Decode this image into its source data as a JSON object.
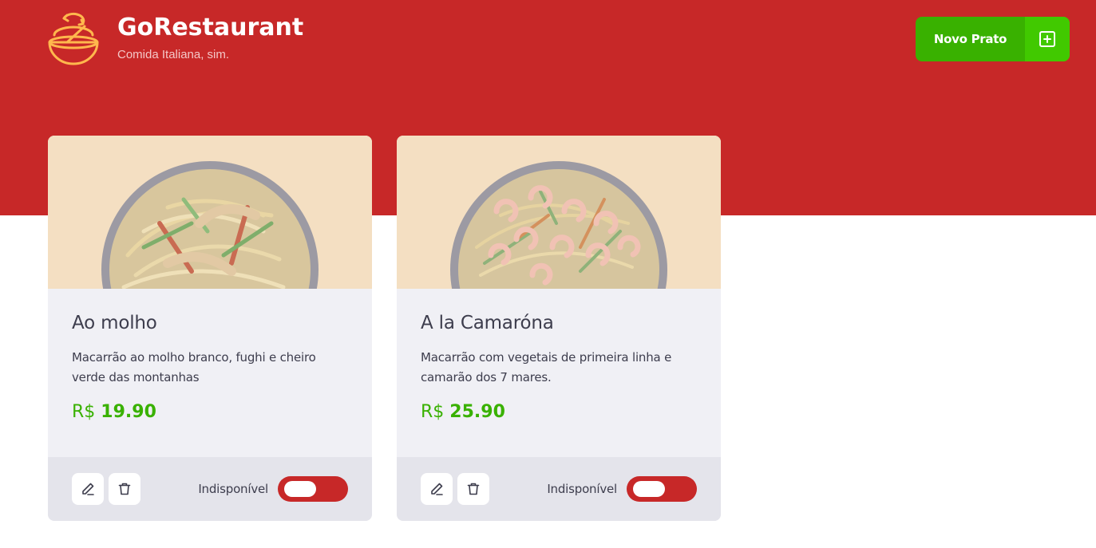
{
  "header": {
    "logo_icon": "bowl-icon",
    "title": "GoRestaurant",
    "subtitle": "Comida Italiana, sim.",
    "new_button": {
      "label": "Novo Prato",
      "icon": "plus-square-icon"
    }
  },
  "colors": {
    "header_bg": "#c72828",
    "accent_green": "#39b100",
    "button_icon_bg": "#41c900",
    "card_bg": "#f0f0f5",
    "card_footer_bg": "#e4e4eb",
    "image_bg": "#f4dfc2",
    "text": "#3d3d4d",
    "logo": "#ffb84d"
  },
  "foods": [
    {
      "name": "Ao molho",
      "description": "Macarrão ao molho branco, fughi e cheiro verde das montanhas",
      "currency": "R$",
      "price": "19.90",
      "available_label": "Indisponível",
      "available": false
    },
    {
      "name": "A la Camaróna",
      "description": "Macarrão com vegetais de primeira linha e camarão dos 7 mares.",
      "currency": "R$",
      "price": "25.90",
      "available_label": "Indisponível",
      "available": false
    }
  ]
}
